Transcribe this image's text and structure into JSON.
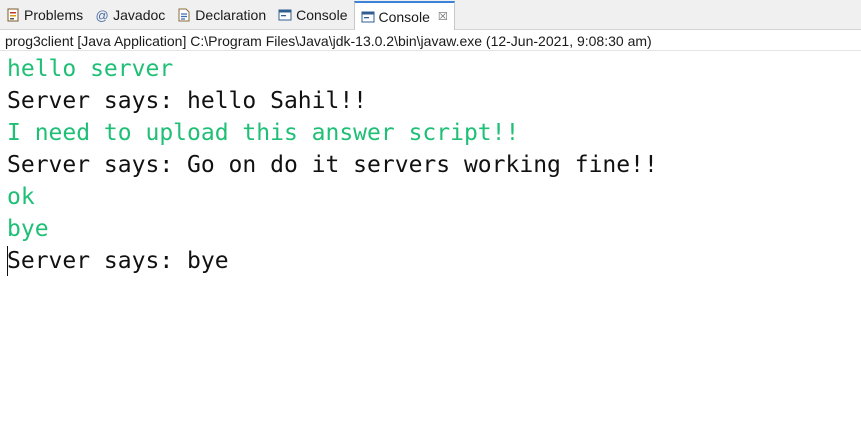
{
  "tabs": [
    {
      "id": "problems",
      "label": "Problems",
      "icon": "problems-icon",
      "active": false
    },
    {
      "id": "javadoc",
      "label": "Javadoc",
      "icon": "at-icon",
      "active": false
    },
    {
      "id": "declaration",
      "label": "Declaration",
      "icon": "declaration-icon",
      "active": false
    },
    {
      "id": "console1",
      "label": "Console",
      "icon": "console-icon",
      "active": false
    },
    {
      "id": "console2",
      "label": "Console",
      "icon": "console-icon",
      "active": true,
      "close": "☒"
    }
  ],
  "status_line": "prog3client [Java Application] C:\\Program Files\\Java\\jdk-13.0.2\\bin\\javaw.exe (12-Jun-2021, 9:08:30 am)",
  "console_lines": [
    {
      "text": "hello server",
      "kind": "input"
    },
    {
      "text": "Server says: hello Sahil!!",
      "kind": "output"
    },
    {
      "text": "I need to upload this answer script!!",
      "kind": "input"
    },
    {
      "text": "Server says: Go on do it servers working fine!!",
      "kind": "output"
    },
    {
      "text": "ok",
      "kind": "input"
    },
    {
      "text": "bye",
      "kind": "input"
    },
    {
      "text": "Server says: bye",
      "kind": "output"
    }
  ],
  "colors": {
    "input_text": "#1fbf76",
    "output_text": "#111111",
    "active_tab_accent": "#3c82d6"
  }
}
